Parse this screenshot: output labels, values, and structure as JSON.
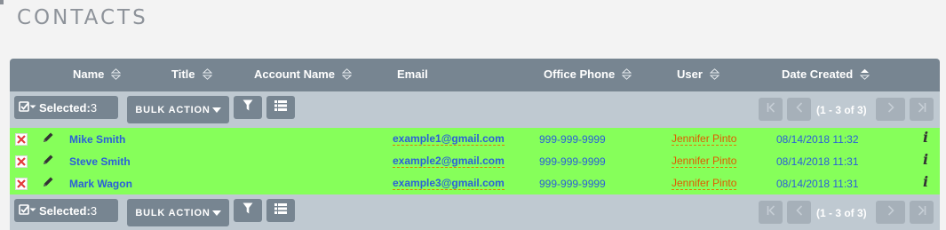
{
  "page": {
    "title": "CONTACTS"
  },
  "columns": {
    "name": "Name",
    "title": "Title",
    "account_name": "Account Name",
    "email": "Email",
    "office_phone": "Office Phone",
    "user": "User",
    "date_created": "Date Created"
  },
  "toolbar": {
    "selected_label": "Selected:",
    "selected_count": "3",
    "bulk_action": "BULK ACTION",
    "pagination": "(1 - 3 of 3)"
  },
  "rows": [
    {
      "name": "Mike Smith",
      "email": "example1@gmail.com",
      "phone": "999-999-9999",
      "user": "Jennifer Pinto",
      "date": "08/14/2018 11:32"
    },
    {
      "name": "Steve Smith",
      "email": "example2@gmail.com",
      "phone": "999-999-9999",
      "user": "Jennifer Pinto",
      "date": "08/14/2018 11:31"
    },
    {
      "name": "Mark Wagon",
      "email": "example3@gmail.com",
      "phone": "999-999-9999",
      "user": "Jennifer Pinto",
      "date": "08/14/2018 11:31"
    }
  ],
  "icons": {
    "sort": "sort-icon",
    "sort_active": "sort-active-icon",
    "checkbox": "checkbox-icon",
    "filter": "filter-icon",
    "columns": "column-chooser-icon",
    "delete": "delete-icon",
    "edit": "pencil-icon",
    "info": "info-icon"
  },
  "colors": {
    "header_bg": "#778591",
    "toolbar_bg": "#bfc9d1",
    "row_highlight": "#86ff5a",
    "link": "#2b5fd9",
    "user_link": "#e05a00"
  }
}
